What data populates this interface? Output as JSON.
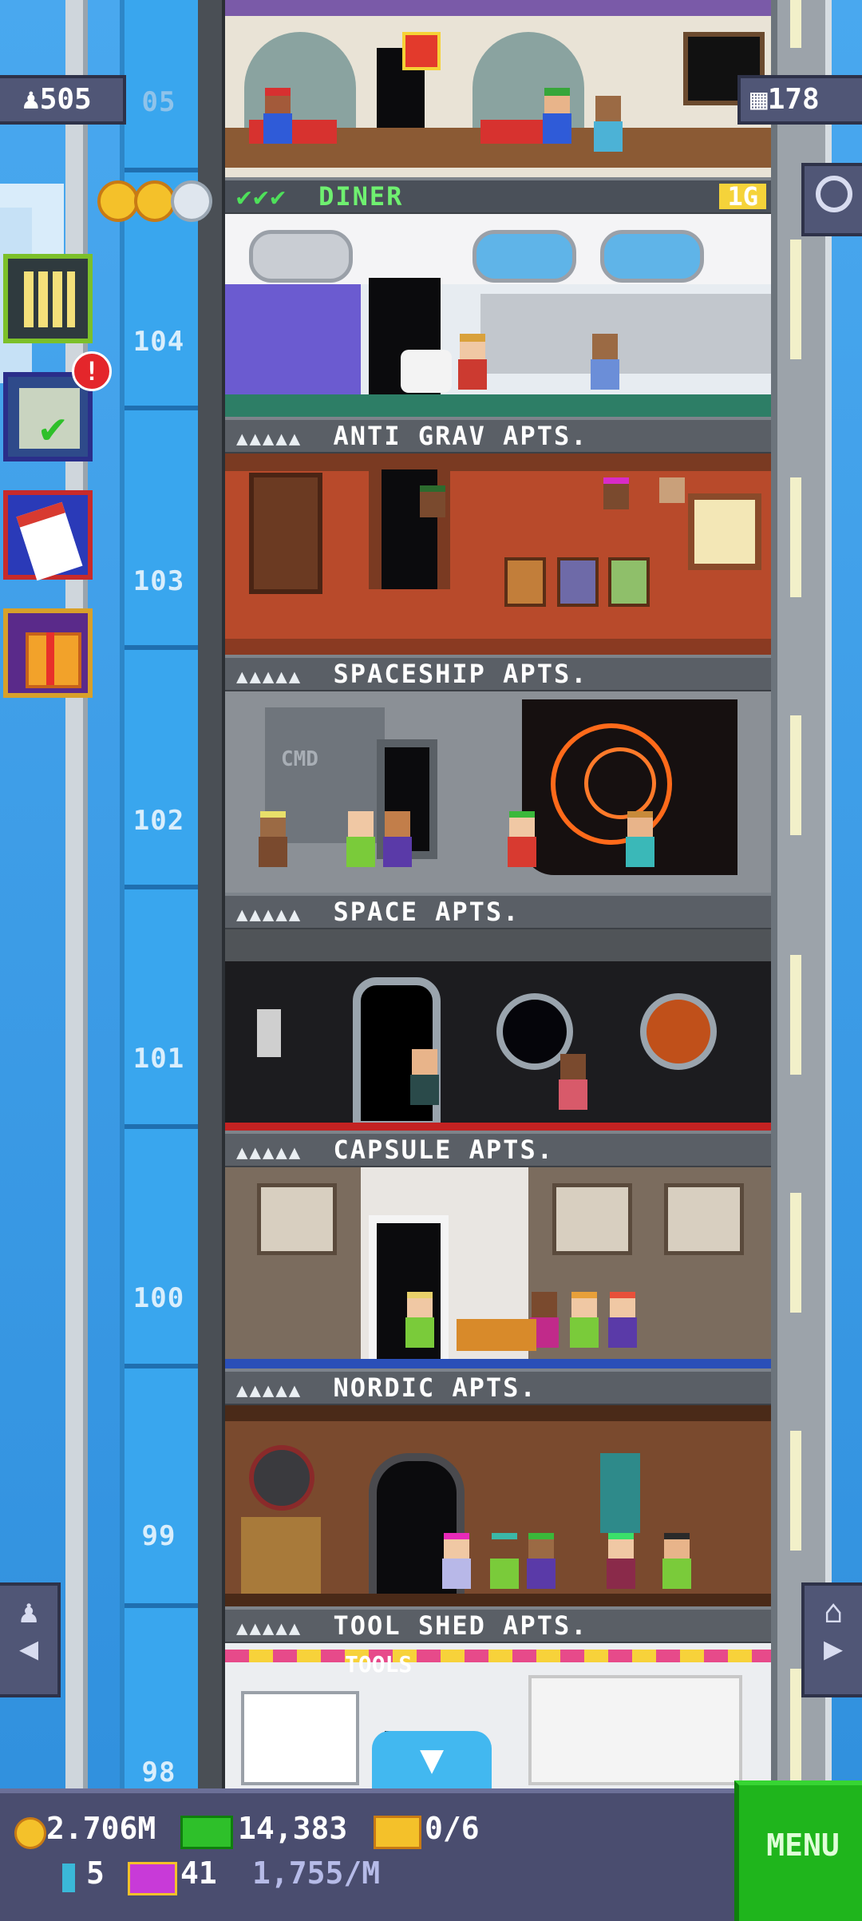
{
  "top_left": {
    "population": "505",
    "faded_text": "05"
  },
  "top_right": {
    "floor_count": "178"
  },
  "floor_numbers": [
    "104",
    "103",
    "102",
    "101",
    "100",
    "99",
    "98"
  ],
  "diner": {
    "name": "DINER",
    "badge": "1G",
    "checks": "✔✔✔",
    "stars_filled": 2,
    "stars_total": 3
  },
  "floors": [
    {
      "name": "ANTI GRAV APTS.",
      "stars": "▲▲▲▲▲"
    },
    {
      "name": "SPACESHIP APTS.",
      "stars": "▲▲▲▲▲"
    },
    {
      "name": "SPACE APTS.",
      "stars": "▲▲▲▲▲"
    },
    {
      "name": "CAPSULE APTS.",
      "stars": "▲▲▲▲▲"
    },
    {
      "name": "NORDIC APTS.",
      "stars": "▲▲▲▲▲"
    },
    {
      "name": "TOOL SHED APTS.",
      "stars": "▲▲▲▲▲"
    }
  ],
  "signs": {
    "cmd": "CMD",
    "tools": "TOOLS"
  },
  "side_buttons": {
    "notification_count": "!"
  },
  "footer": {
    "coins": "2.706M",
    "bux": "14,383",
    "tickets": "0/6",
    "bitizens": "5",
    "vip": "41",
    "rate": "1,755/M",
    "menu_label": "MENU"
  },
  "colors": {
    "sky": "#3d9be6",
    "footer": "#4a4d6f",
    "menu": "#1fb51c"
  }
}
